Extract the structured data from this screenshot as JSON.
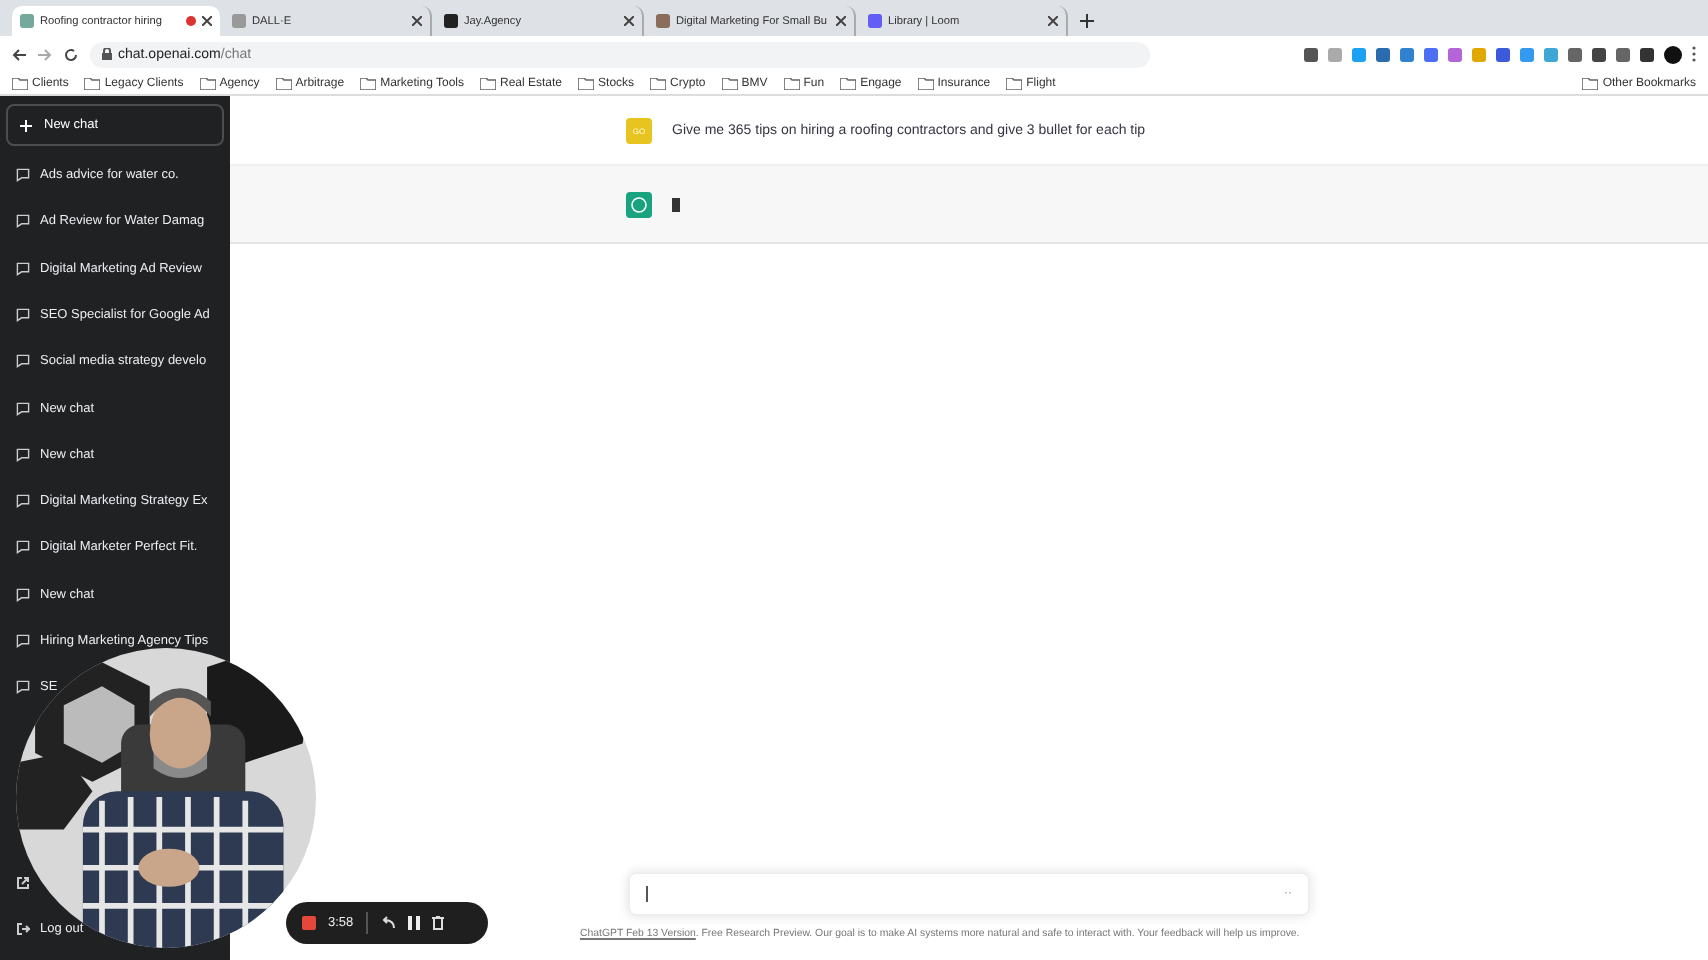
{
  "browser": {
    "tabs": [
      {
        "title": "Roofing contractor hiring",
        "selected": true,
        "recording": true
      },
      {
        "title": "DALL·E",
        "selected": false,
        "recording": false
      },
      {
        "title": "Jay.Agency",
        "selected": false,
        "recording": false
      },
      {
        "title": "Digital Marketing For Small Bu",
        "selected": false,
        "recording": false
      },
      {
        "title": "Library | Loom",
        "selected": false,
        "recording": false
      }
    ],
    "url_host": "chat.openai.com",
    "url_path": "/chat",
    "bookmarks": [
      "Clients",
      "Legacy Clients",
      "Agency",
      "Arbitrage",
      "Marketing Tools",
      "Real Estate",
      "Stocks",
      "Crypto",
      "BMV",
      "Fun",
      "Engage",
      "Insurance",
      "Flight"
    ],
    "other_bookmarks": "Other Bookmarks"
  },
  "sidebar": {
    "new_chat": "New chat",
    "items": [
      "Ads advice for water co.",
      "Ad Review for Water Damag",
      "Digital Marketing Ad Review",
      "SEO Specialist for Google Ad",
      "Social media strategy develo",
      "New chat",
      "New chat",
      "Digital Marketing Strategy Ex",
      "Digital Marketer Perfect Fit.",
      "New chat",
      "Hiring Marketing Agency Tips",
      "SE"
    ],
    "log_out": "Log out"
  },
  "chat": {
    "user_avatar": "GO",
    "user_message": "Give me 365 tips on hiring a roofing contractors and give 3 bullet for each tip"
  },
  "composer": {
    "more": "··"
  },
  "footer": {
    "link": "ChatGPT Feb 13 Version",
    "text": ". Free Research Preview. Our goal is to make AI systems more natural and safe to interact with. Your feedback will help us improve."
  },
  "recorder": {
    "time": "3:58"
  }
}
